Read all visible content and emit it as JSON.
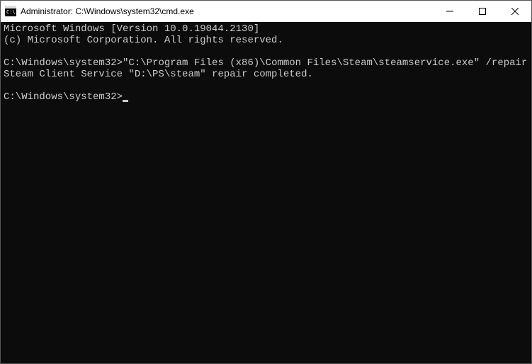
{
  "window": {
    "title": "Administrator: C:\\Windows\\system32\\cmd.exe"
  },
  "terminal": {
    "header_line1": "Microsoft Windows [Version 10.0.19044.2130]",
    "header_line2": "(c) Microsoft Corporation. All rights reserved.",
    "prompt1": "C:\\Windows\\system32>",
    "command1": "\"C:\\Program Files (x86)\\Common Files\\Steam\\steamservice.exe\" /repair",
    "output1": "Steam Client Service \"D:\\PS\\steam\" repair completed.",
    "prompt2": "C:\\Windows\\system32>"
  }
}
